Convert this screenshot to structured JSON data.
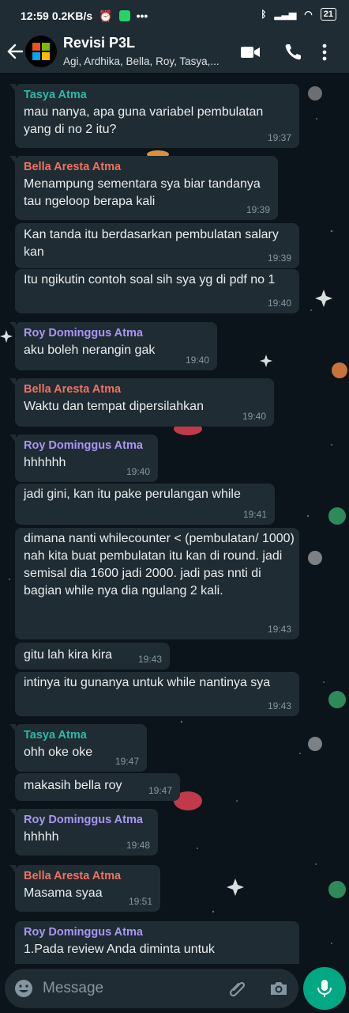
{
  "status_bar": {
    "time": "12:59",
    "network_speed": "0.2KB/s",
    "battery": "21"
  },
  "header": {
    "title": "Revisi P3L",
    "subtitle": "Agi, Ardhika, Bella, Roy, Tasya,..."
  },
  "colors": {
    "tasya": "#2fb8a6",
    "bella": "#f0715f",
    "roy": "#a896f5",
    "accent": "#00a884"
  },
  "messages": [
    {
      "sender": "Tasya Atma",
      "text": "mau nanya, apa guna variabel pembulatan yang di no 2 itu?",
      "time": "19:37"
    },
    {
      "sender": "Bella Aresta Atma",
      "text": "Menampung sementara sya biar tandanya tau ngeloop berapa kali",
      "time": "19:39"
    },
    {
      "sender": "",
      "text": "Kan tanda itu berdasarkan pembulatan salary kan",
      "time": "19:39"
    },
    {
      "sender": "",
      "text": "Itu ngikutin contoh soal sih sya yg di pdf no 1",
      "time": "19:40"
    },
    {
      "sender": "Roy Dominggus Atma",
      "text": "aku boleh nerangin gak",
      "time": "19:40"
    },
    {
      "sender": "Bella Aresta Atma",
      "text": "Waktu dan tempat dipersilahkan",
      "time": "19:40"
    },
    {
      "sender": "Roy Dominggus Atma",
      "text": "hhhhhh",
      "time": "19:40"
    },
    {
      "sender": "",
      "text": "jadi gini, kan itu pake perulangan while",
      "time": "19:41"
    },
    {
      "sender": "",
      "text": "dimana nanti whilecounter < (pembulatan/ 1000)\nnah kita buat pembulatan itu kan di round. jadi semisal dia 1600 jadi 2000. jadi pas nnti di bagian while nya dia ngulang 2 kali.",
      "time": "19:43"
    },
    {
      "sender": "",
      "text": "gitu lah kira kira",
      "time": "19:43"
    },
    {
      "sender": "",
      "text": "intinya itu gunanya untuk while nantinya sya",
      "time": "19:43"
    },
    {
      "sender": "Tasya Atma",
      "text": "ohh oke oke",
      "time": "19:47"
    },
    {
      "sender": "",
      "text": "makasih bella roy",
      "time": "19:47"
    },
    {
      "sender": "Roy Dominggus Atma",
      "text": "hhhhh",
      "time": "19:48"
    },
    {
      "sender": "Bella Aresta Atma",
      "text": "Masama syaa",
      "time": "19:51"
    },
    {
      "sender": "Roy Dominggus Atma",
      "text": "1.Pada review Anda diminta untuk",
      "time": ""
    }
  ],
  "composer": {
    "placeholder": "Message"
  },
  "icons": [
    "back-arrow-icon",
    "video-call-icon",
    "voice-call-icon",
    "more-options-icon",
    "emoji-icon",
    "attach-icon",
    "camera-icon",
    "mic-icon"
  ]
}
